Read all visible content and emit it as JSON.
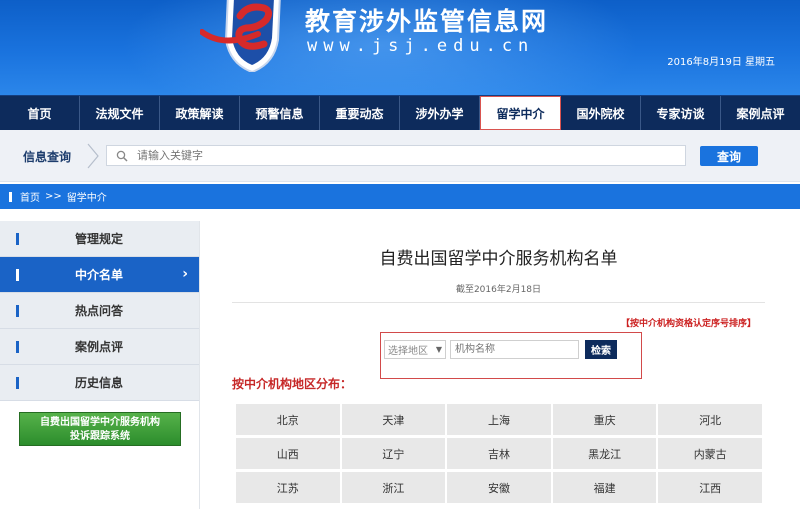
{
  "header": {
    "site_title": "教育涉外监管信息网",
    "site_url": "www.jsj.edu.cn",
    "date": "2016年8月19日  星期五"
  },
  "nav": {
    "items": [
      "首页",
      "法规文件",
      "政策解读",
      "预警信息",
      "重要动态",
      "涉外办学",
      "留学中介",
      "国外院校",
      "专家访谈",
      "案例点评"
    ],
    "active_index": 6
  },
  "search": {
    "label": "信息查询",
    "placeholder": "请输入关键字",
    "button": "查询"
  },
  "breadcrumb": {
    "home": "首页",
    "separator": ">>",
    "current": "留学中介"
  },
  "sidebar": {
    "items": [
      "管理规定",
      "中介名单",
      "热点问答",
      "案例点评",
      "历史信息"
    ],
    "active_index": 1,
    "complaint_line1": "自费出国留学中介服务机构",
    "complaint_line2": "投诉跟踪系统"
  },
  "main": {
    "title": "自费出国留学中介服务机构名单",
    "date": "截至2016年2月18日",
    "sort_note": "【按中介机构资格认定序号排序】",
    "region_select": "选择地区",
    "name_placeholder": "机构名称",
    "filter_button": "检索",
    "region_heading": "按中介机构地区分布：",
    "regions": [
      "北京",
      "天津",
      "上海",
      "重庆",
      "河北",
      "山西",
      "辽宁",
      "吉林",
      "黑龙江",
      "内蒙古",
      "江苏",
      "浙江",
      "安徽",
      "福建",
      "江西"
    ]
  },
  "colors": {
    "brand_blue": "#1a73de",
    "nav_dark": "#0d2b5c",
    "accent_red": "#c62828"
  }
}
